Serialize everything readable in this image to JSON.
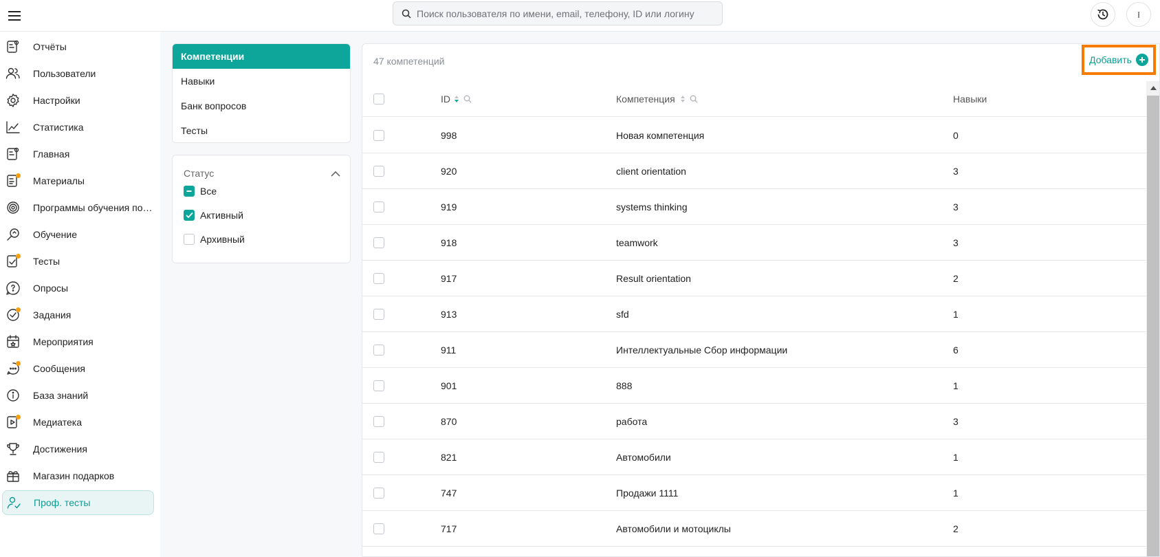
{
  "header": {
    "search_placeholder": "Поиск пользователя по имени, email, телефону, ID или логину",
    "avatar_initial": "I"
  },
  "sidebar": {
    "items": [
      {
        "label": "Отчёты",
        "icon": "reports-icon"
      },
      {
        "label": "Пользователи",
        "icon": "users-icon"
      },
      {
        "label": "Настройки",
        "icon": "gear-icon"
      },
      {
        "label": "Статистика",
        "icon": "chart-icon"
      },
      {
        "label": "Главная",
        "icon": "home-icon"
      },
      {
        "label": "Материалы",
        "icon": "materials-icon",
        "dot": true
      },
      {
        "label": "Программы обучения по специальностям",
        "icon": "programs-icon"
      },
      {
        "label": "Обучение",
        "icon": "learning-icon"
      },
      {
        "label": "Тесты",
        "icon": "tests-icon",
        "dot": true
      },
      {
        "label": "Опросы",
        "icon": "surveys-icon"
      },
      {
        "label": "Задания",
        "icon": "tasks-icon",
        "dot": true
      },
      {
        "label": "Мероприятия",
        "icon": "calendar-icon"
      },
      {
        "label": "Сообщения",
        "icon": "messages-icon",
        "dot": true
      },
      {
        "label": "База знаний",
        "icon": "info-icon"
      },
      {
        "label": "Медиатека",
        "icon": "media-icon",
        "dot": true
      },
      {
        "label": "Достижения",
        "icon": "trophy-icon"
      },
      {
        "label": "Магазин подарков",
        "icon": "gift-icon"
      },
      {
        "label": "Проф. тесты",
        "icon": "prof-tests-icon",
        "active": true
      }
    ]
  },
  "subnav": {
    "items": [
      {
        "label": "Компетенции",
        "active": true
      },
      {
        "label": "Навыки"
      },
      {
        "label": "Банк вопросов"
      },
      {
        "label": "Тесты"
      }
    ]
  },
  "status_filter": {
    "title": "Статус",
    "options": [
      {
        "label": "Все",
        "state": "indeterminate"
      },
      {
        "label": "Активный",
        "state": "checked"
      },
      {
        "label": "Архивный",
        "state": "unchecked"
      }
    ]
  },
  "table": {
    "count_label": "47 компетенций",
    "add_label": "Добавить",
    "columns": {
      "id": "ID",
      "name": "Компетенция",
      "skills": "Навыки"
    },
    "rows": [
      {
        "id": "998",
        "name": "Новая компетенция",
        "skills": "0"
      },
      {
        "id": "920",
        "name": "client orientation",
        "skills": "3"
      },
      {
        "id": "919",
        "name": "systems thinking",
        "skills": "3"
      },
      {
        "id": "918",
        "name": "teamwork",
        "skills": "3"
      },
      {
        "id": "917",
        "name": "Result orientation",
        "skills": "2"
      },
      {
        "id": "913",
        "name": "sfd",
        "skills": "1"
      },
      {
        "id": "911",
        "name": "Интеллектуальные Сбор информации",
        "skills": "6"
      },
      {
        "id": "901",
        "name": "888",
        "skills": "1"
      },
      {
        "id": "870",
        "name": "работа",
        "skills": "3"
      },
      {
        "id": "821",
        "name": "Автомобили",
        "skills": "1"
      },
      {
        "id": "747",
        "name": "Продажи 1111",
        "skills": "1"
      },
      {
        "id": "717",
        "name": "Автомобили и мотоциклы",
        "skills": "2"
      }
    ]
  },
  "colors": {
    "accent": "#0ea69b",
    "highlight": "#f57c00",
    "notification_dot": "#f5a10f"
  }
}
